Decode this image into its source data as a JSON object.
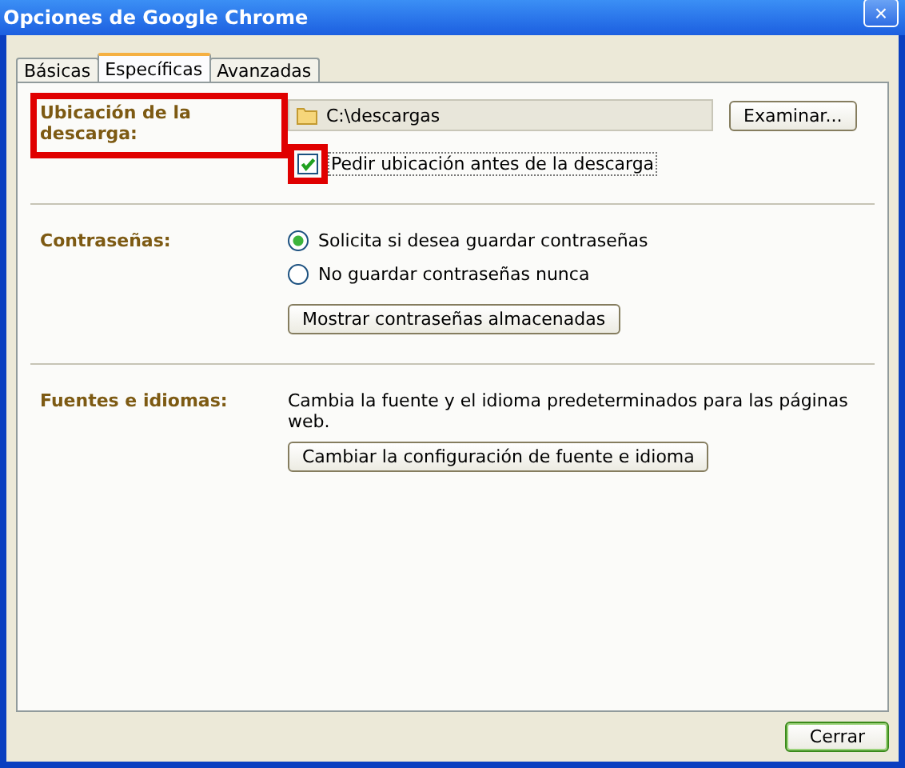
{
  "window": {
    "title": "Opciones de Google Chrome",
    "close": "×"
  },
  "tabs": [
    {
      "label": "Básicas",
      "selected": false
    },
    {
      "label": "Específicas",
      "selected": true
    },
    {
      "label": "Avanzadas",
      "selected": false
    }
  ],
  "download": {
    "label": "Ubicación de la descarga:",
    "path": "C:\\descargas",
    "browse": "Examinar...",
    "ask": {
      "label": "Pedir ubicación antes de la descarga",
      "checked": true
    }
  },
  "passwords": {
    "label": "Contraseñas:",
    "options": [
      {
        "label": "Solicita si desea guardar contraseñas",
        "selected": true
      },
      {
        "label": "No guardar contraseñas nunca",
        "selected": false
      }
    ],
    "button": "Mostrar contraseñas almacenadas"
  },
  "fonts": {
    "label": "Fuentes e idiomas:",
    "description": "Cambia la fuente y el idioma predeterminados para las páginas web.",
    "button": "Cambiar la configuración de fuente e idioma"
  },
  "buttons": [
    "Cerrar"
  ]
}
